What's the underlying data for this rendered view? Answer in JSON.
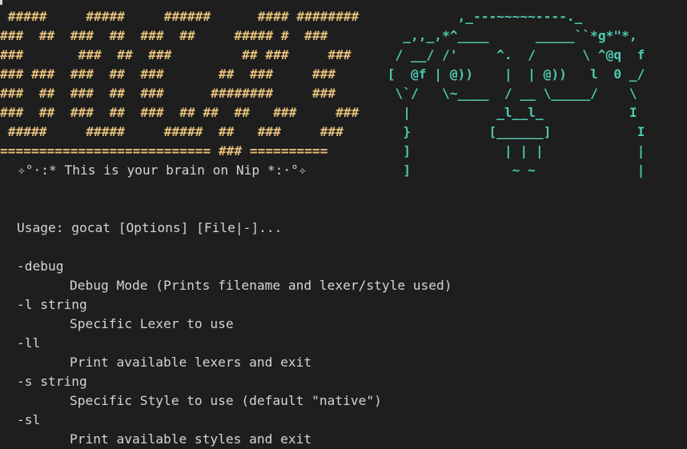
{
  "theme": {
    "background": "#1e1e1e",
    "text": "#d4d4d4",
    "banner_yellow": "#e5c07b",
    "banner_cyan": "#4ec9b0",
    "cursor": "#d4d4d4"
  },
  "banner": {
    "left_art": " #####     #####     ######      #### ########\n###  ##  ###  ##  ###  ##     ##### #  ###\n###       ###  ##  ###         ## ###     ###\n### ###  ###  ##  ###       ##  ###     ###\n###  ##  ###  ##  ###      ########     ###\n###  ##  ###  ##  ###  ## ##  ##   ###     ###\n #####     #####     #####  ##   ###     ###\n=========================== ### ==========",
    "right_art": "          ,_---~~~~~----._\n   _,,_,*^____      _____``*g*\"*,\n  / __/ /'     ^.  /      \\ ^@q  f\n [  @f | @))    |  | @))   l  0 _/\n  \\`/   \\~____  / __ \\_____/    \\\n   |           _l__l_           I\n   }          [______]           I\n   ]            | | |            |\n   ]             ~ ~             |",
    "tagline": "✧°·:* This is your brain on Nip *:·°✧"
  },
  "usage": {
    "line": "Usage: gocat [Options] [File|-]..."
  },
  "options": [
    {
      "flag": "-debug",
      "description": "Debug Mode (Prints filename and lexer/style used)"
    },
    {
      "flag": "-l string",
      "description": "Specific Lexer to use"
    },
    {
      "flag": "-ll",
      "description": "Print available lexers and exit"
    },
    {
      "flag": "-s string",
      "description": "Specific Style to use (default \"native\")"
    },
    {
      "flag": "-sl",
      "description": "Print available styles and exit"
    }
  ]
}
